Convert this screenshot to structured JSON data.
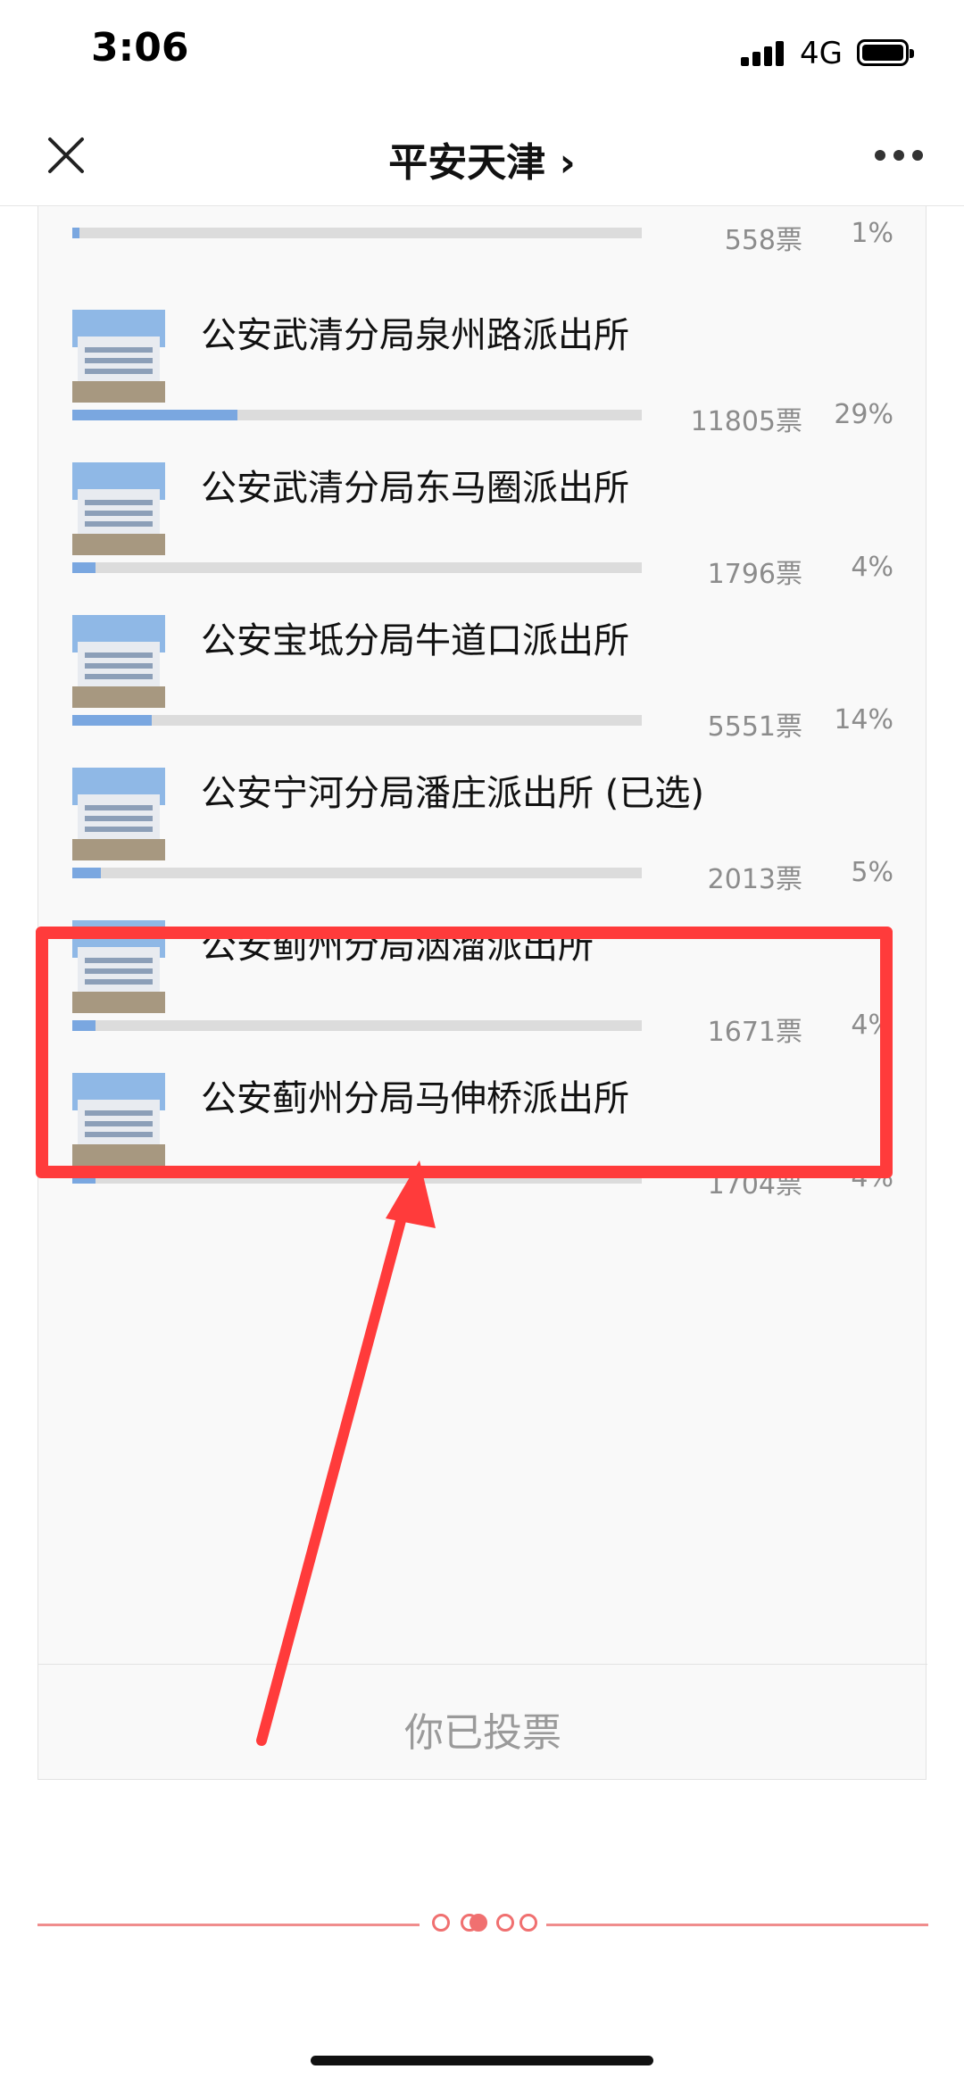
{
  "status": {
    "time": "3:06",
    "network": "4G"
  },
  "nav": {
    "title": "平安天津 ›"
  },
  "poll": {
    "top_partial": {
      "votes": "558票",
      "percent": "1%",
      "share": 0.012
    },
    "options": [
      {
        "name": "公安武清分局泉州路派出所",
        "votes": "11805票",
        "percent": "29%",
        "share": 0.29
      },
      {
        "name": "公安武清分局东马圈派出所",
        "votes": "1796票",
        "percent": "4%",
        "share": 0.04
      },
      {
        "name": "公安宝坻分局牛道口派出所",
        "votes": "5551票",
        "percent": "14%",
        "share": 0.14
      },
      {
        "name": "公安宁河分局潘庄派出所 (已选)",
        "votes": "2013票",
        "percent": "5%",
        "share": 0.05
      },
      {
        "name": "公安蓟州分局洇溜派出所",
        "votes": "1671票",
        "percent": "4%",
        "share": 0.04
      },
      {
        "name": "公安蓟州分局马伸桥派出所",
        "votes": "1704票",
        "percent": "4%",
        "share": 0.04
      }
    ],
    "voted_label": "你已投票"
  },
  "colors": {
    "accent": "#ff3b3b",
    "bar_fill": "#7aa7e0",
    "bar_track": "#dcdcdc"
  }
}
